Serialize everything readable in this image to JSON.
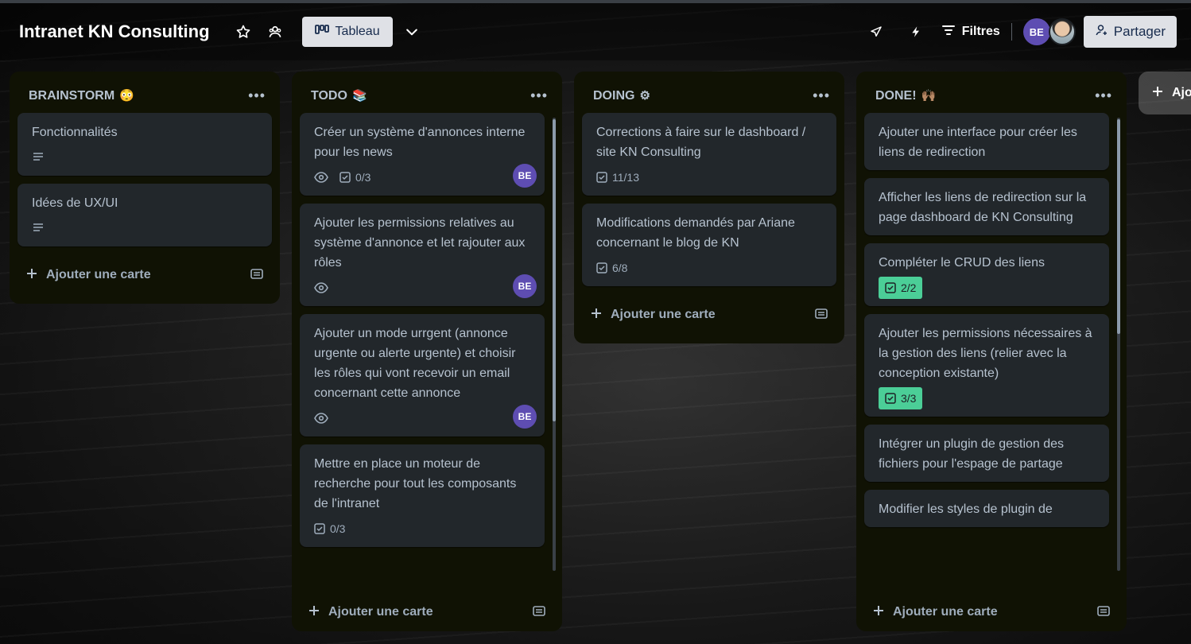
{
  "header": {
    "board_title": "Intranet KN Consulting",
    "view_label": "Tableau",
    "filters_label": "Filtres",
    "share_label": "Partager",
    "avatar_initials": "BE"
  },
  "lists": [
    {
      "title": "BRAINSTORM",
      "emoji": "😳",
      "add_label": "Ajouter une carte",
      "cards": [
        {
          "title": "Fonctionnalités",
          "description": true
        },
        {
          "title": "Idées de UX/UI",
          "description": true
        }
      ]
    },
    {
      "title": "TODO",
      "emoji": "📚",
      "add_label": "Ajouter une carte",
      "cards": [
        {
          "title": "Créer un système d'annonces interne pour les news",
          "watch": true,
          "checklist": "0/3",
          "member": "BE"
        },
        {
          "title": "Ajouter les permissions relatives au système d'annonce et let rajouter aux rôles",
          "watch": true,
          "member": "BE"
        },
        {
          "title": "Ajouter un mode urrgent (annonce urgente ou alerte urgente) et choisir les rôles qui vont recevoir un email concernant cette annonce",
          "watch": true,
          "member": "BE"
        },
        {
          "title": "Mettre en place un moteur de recherche pour tout les composants de l'intranet",
          "checklist": "0/3"
        }
      ]
    },
    {
      "title": "DOING",
      "emoji": "⚙",
      "add_label": "Ajouter une carte",
      "cards": [
        {
          "title": "Corrections à faire sur le dashboard / site KN Consulting",
          "checklist": "11/13"
        },
        {
          "title": "Modifications demandés par Ariane concernant le blog de KN",
          "checklist": "6/8"
        }
      ]
    },
    {
      "title": "DONE!",
      "emoji": "🙌🏽",
      "add_label": "Ajouter une carte",
      "cards": [
        {
          "title": "Ajouter une interface pour créer les liens de redirection"
        },
        {
          "title": "Afficher les liens de redirection sur la page dashboard de KN Consulting"
        },
        {
          "title": "Compléter le CRUD des liens",
          "checklist": "2/2",
          "complete": true
        },
        {
          "title": "Ajouter les permissions nécessaires à la gestion des liens (relier avec la conception existante)",
          "checklist": "3/3",
          "complete": true
        },
        {
          "title": "Intégrer un plugin de gestion des fichiers pour l'espage de partage"
        },
        {
          "title": "Modifier les styles de plugin de"
        }
      ]
    }
  ],
  "add_list_label": "Ajo"
}
